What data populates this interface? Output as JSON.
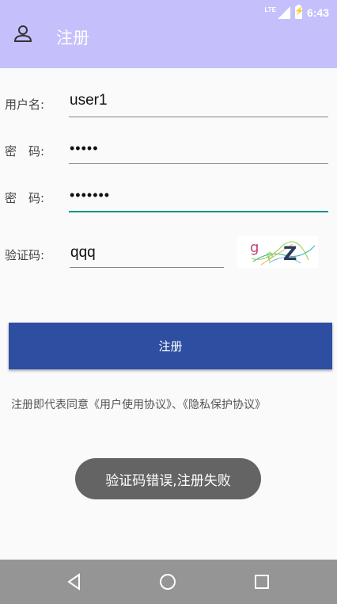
{
  "status_bar": {
    "network": "LTE",
    "time": "6:43"
  },
  "app_bar": {
    "title": "注册",
    "icon": "user-icon"
  },
  "form": {
    "username_label": "用户名:",
    "username_value": "user1",
    "password_label": "密　码:",
    "password_value": "•••••",
    "confirm_label": "密　码:",
    "confirm_value": "•••••••",
    "captcha_label": "验证码:",
    "captcha_value": "qqq",
    "captcha_image_text": "gpZ"
  },
  "register_button": "注册",
  "agreement_text": "注册即代表同意《用户使用协议》、《隐私保护协议》",
  "toast": "验证码错误,注册失败",
  "nav": {
    "back_icon": "back-triangle-icon",
    "home_icon": "home-circle-icon",
    "recents_icon": "recents-square-icon"
  },
  "colors": {
    "app_bar": "#c5c0fb",
    "button": "#2e4fa1",
    "focus": "#139187",
    "nav_bar": "#959595",
    "toast": "#646464"
  }
}
